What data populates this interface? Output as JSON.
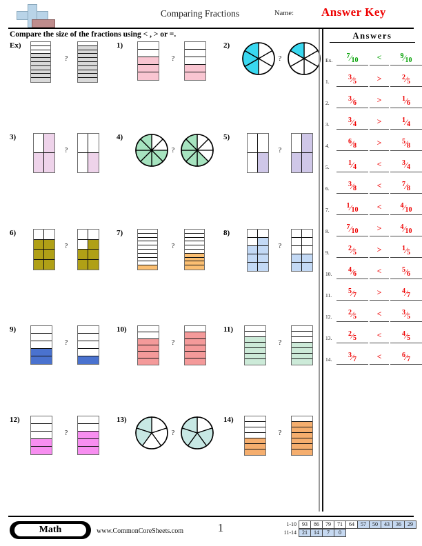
{
  "header": {
    "title": "Comparing Fractions",
    "name_label": "Name:",
    "answer_key_stamp": "Answer Key",
    "logo_icon": "plus-block-logo"
  },
  "instructions": "Compare the size of the fractions using < , > or =.",
  "answers_panel": {
    "heading": "Answers",
    "rows": [
      {
        "num": "Ex.",
        "left_n": "7",
        "left_d": "10",
        "op": "<",
        "right_n": "9",
        "right_d": "10",
        "color": "#00a000"
      },
      {
        "num": "1.",
        "left_n": "3",
        "left_d": "5",
        "op": ">",
        "right_n": "2",
        "right_d": "5",
        "color": "#ee0000"
      },
      {
        "num": "2.",
        "left_n": "3",
        "left_d": "6",
        "op": ">",
        "right_n": "1",
        "right_d": "6",
        "color": "#ee0000"
      },
      {
        "num": "3.",
        "left_n": "3",
        "left_d": "4",
        "op": ">",
        "right_n": "1",
        "right_d": "4",
        "color": "#ee0000"
      },
      {
        "num": "4.",
        "left_n": "6",
        "left_d": "8",
        "op": ">",
        "right_n": "5",
        "right_d": "8",
        "color": "#ee0000"
      },
      {
        "num": "5.",
        "left_n": "1",
        "left_d": "4",
        "op": "<",
        "right_n": "3",
        "right_d": "4",
        "color": "#ee0000"
      },
      {
        "num": "6.",
        "left_n": "3",
        "left_d": "8",
        "op": "<",
        "right_n": "7",
        "right_d": "8",
        "color": "#ee0000"
      },
      {
        "num": "7.",
        "left_n": "1",
        "left_d": "10",
        "op": "<",
        "right_n": "4",
        "right_d": "10",
        "color": "#ee0000"
      },
      {
        "num": "8.",
        "left_n": "7",
        "left_d": "10",
        "op": ">",
        "right_n": "4",
        "right_d": "10",
        "color": "#ee0000"
      },
      {
        "num": "9.",
        "left_n": "2",
        "left_d": "5",
        "op": ">",
        "right_n": "1",
        "right_d": "5",
        "color": "#ee0000"
      },
      {
        "num": "10.",
        "left_n": "4",
        "left_d": "6",
        "op": "<",
        "right_n": "5",
        "right_d": "6",
        "color": "#ee0000"
      },
      {
        "num": "11.",
        "left_n": "5",
        "left_d": "7",
        "op": ">",
        "right_n": "4",
        "right_d": "7",
        "color": "#ee0000"
      },
      {
        "num": "12.",
        "left_n": "2",
        "left_d": "5",
        "op": "<",
        "right_n": "3",
        "right_d": "5",
        "color": "#ee0000"
      },
      {
        "num": "13.",
        "left_n": "2",
        "left_d": "5",
        "op": "<",
        "right_n": "4",
        "right_d": "5",
        "color": "#ee0000"
      },
      {
        "num": "14.",
        "left_n": "3",
        "left_d": "7",
        "op": "<",
        "right_n": "6",
        "right_d": "7",
        "color": "#ee0000"
      }
    ]
  },
  "problems": [
    {
      "label": "Ex)",
      "shape": "bar",
      "denominator": 10,
      "left_shaded": 7,
      "right_shaded": 9,
      "color": "#d9d9d9",
      "question_mark": "?"
    },
    {
      "label": "1)",
      "shape": "bar",
      "denominator": 5,
      "left_shaded": 3,
      "right_shaded": 2,
      "color": "#f9c5d1",
      "question_mark": "?"
    },
    {
      "label": "2)",
      "shape": "pie",
      "denominator": 6,
      "left_shaded": 3,
      "right_shaded": 1,
      "color": "#39d8f0",
      "question_mark": "?"
    },
    {
      "label": "3)",
      "shape": "grid2",
      "denominator": 4,
      "left_shaded": 3,
      "right_shaded": 1,
      "color": "#eed3ea",
      "question_mark": "?"
    },
    {
      "label": "4)",
      "shape": "pie",
      "denominator": 8,
      "left_shaded": 6,
      "right_shaded": 5,
      "color": "#a6e3bf",
      "question_mark": "?"
    },
    {
      "label": "5)",
      "shape": "grid2",
      "denominator": 4,
      "left_shaded": 1,
      "right_shaded": 3,
      "color": "#cfc7e8",
      "question_mark": "?"
    },
    {
      "label": "6)",
      "shape": "grid2",
      "denominator": 8,
      "left_shaded": 6,
      "right_shaded": 5,
      "color": "#b0a016",
      "question_mark": "?"
    },
    {
      "label": "7)",
      "shape": "bar",
      "denominator": 10,
      "left_shaded": 1,
      "right_shaded": 4,
      "color": "#fbbf72",
      "question_mark": "?"
    },
    {
      "label": "8)",
      "shape": "grid2",
      "denominator": 10,
      "left_shaded": 7,
      "right_shaded": 4,
      "color": "#c3d9f5",
      "question_mark": "?"
    },
    {
      "label": "9)",
      "shape": "bar",
      "denominator": 5,
      "left_shaded": 2,
      "right_shaded": 1,
      "color": "#4a72cf",
      "question_mark": "?"
    },
    {
      "label": "10)",
      "shape": "bar",
      "denominator": 6,
      "left_shaded": 4,
      "right_shaded": 5,
      "color": "#f49a9a",
      "question_mark": "?"
    },
    {
      "label": "11)",
      "shape": "bar",
      "denominator": 7,
      "left_shaded": 5,
      "right_shaded": 4,
      "color": "#ccead8",
      "question_mark": "?"
    },
    {
      "label": "12)",
      "shape": "bar",
      "denominator": 5,
      "left_shaded": 2,
      "right_shaded": 3,
      "color": "#f78ef0",
      "question_mark": "?"
    },
    {
      "label": "13)",
      "shape": "pie",
      "denominator": 5,
      "left_shaded": 2,
      "right_shaded": 4,
      "color": "#c7e8e4",
      "question_mark": "?"
    },
    {
      "label": "14)",
      "shape": "bar",
      "denominator": 7,
      "left_shaded": 3,
      "right_shaded": 6,
      "color": "#f5ae6e",
      "question_mark": "?"
    }
  ],
  "footer": {
    "subject_badge": "Math",
    "site_url": "www.CommonCoreSheets.com",
    "page_number": "1",
    "score_table": {
      "row1_label": "1-10",
      "row1_values": [
        "93",
        "86",
        "79",
        "71",
        "64",
        "57",
        "50",
        "43",
        "36",
        "29"
      ],
      "row1_filled": [
        false,
        false,
        false,
        false,
        false,
        true,
        true,
        true,
        true,
        true
      ],
      "row2_label": "11-14",
      "row2_values": [
        "21",
        "14",
        "7",
        "0"
      ],
      "row2_filled": [
        true,
        true,
        true,
        true
      ]
    }
  }
}
